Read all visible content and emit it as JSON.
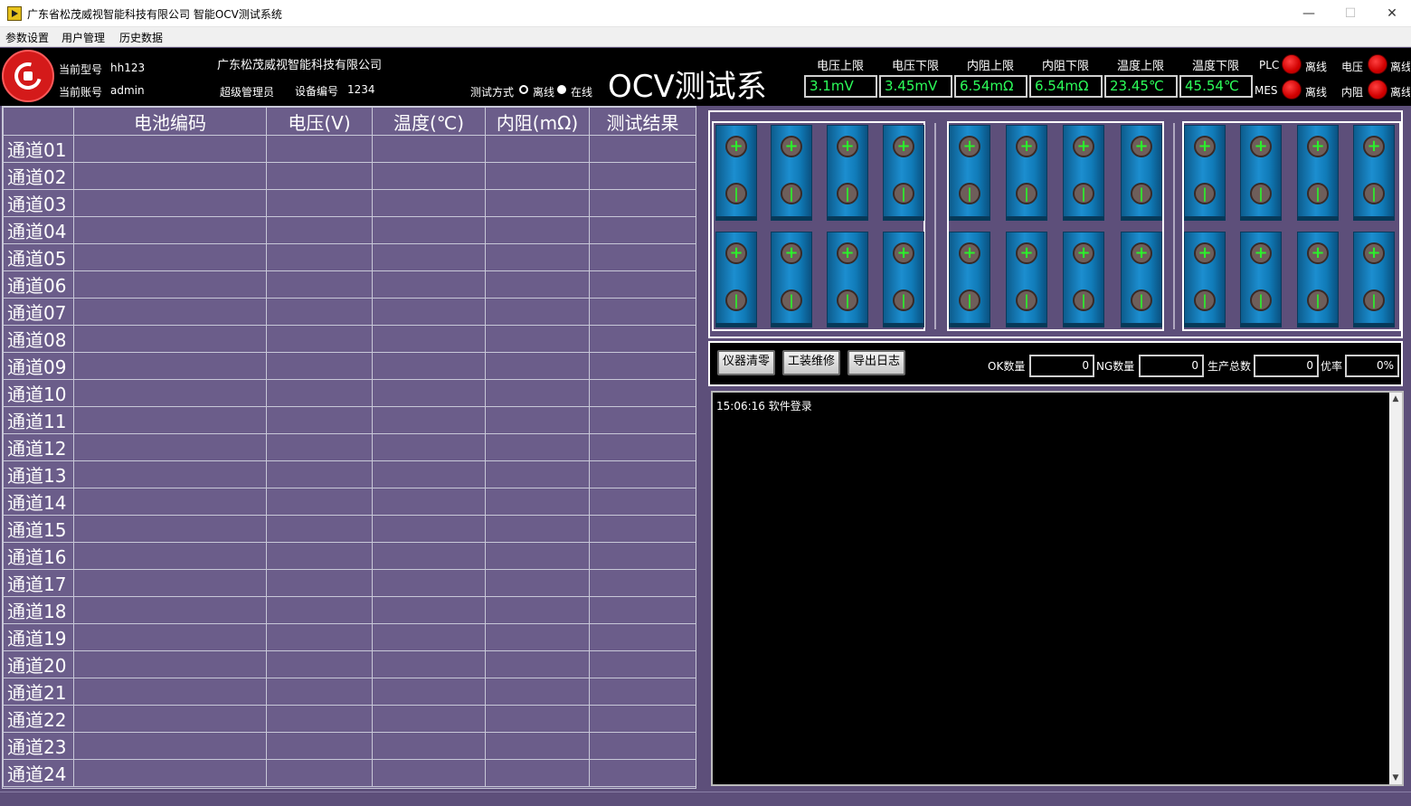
{
  "window": {
    "title": "广东省松茂威视智能科技有限公司 智能OCV测试系统",
    "min": "—",
    "max": "☐",
    "close": "✕"
  },
  "menu": [
    "参数设置",
    "用户管理",
    "历史数据"
  ],
  "header": {
    "model_label": "当前型号",
    "model_value": "hh123",
    "account_label": "当前账号",
    "account_value": "admin",
    "company": "广东松茂威视智能科技有限公司",
    "role": "超级管理员",
    "device_label": "设备编号",
    "device_value": "1234",
    "test_mode_label": "测试方式",
    "mode_offline": "离线",
    "mode_online": "在线",
    "mode_selected": "在线",
    "system_title": "OCV测试系",
    "limits": [
      {
        "label": "电压上限",
        "value": "3.1mV"
      },
      {
        "label": "电压下限",
        "value": "3.45mV"
      },
      {
        "label": "内阻上限",
        "value": "6.54mΩ"
      },
      {
        "label": "内阻下限",
        "value": "6.54mΩ"
      },
      {
        "label": "温度上限",
        "value": "23.45℃"
      },
      {
        "label": "温度下限",
        "value": "45.54℃"
      }
    ],
    "status": [
      {
        "label": "PLC",
        "state": "离线"
      },
      {
        "label": "MES",
        "state": "离线"
      },
      {
        "label": "电压",
        "state": "离线"
      },
      {
        "label": "内阻",
        "state": "离线"
      }
    ],
    "led_color": "#e00000"
  },
  "table": {
    "columns": [
      "",
      "电池编码",
      "电压(V)",
      "温度(℃)",
      "内阻(mΩ)",
      "测试结果"
    ],
    "channels": [
      "通道01",
      "通道02",
      "通道03",
      "通道04",
      "通道05",
      "通道06",
      "通道07",
      "通道08",
      "通道09",
      "通道10",
      "通道11",
      "通道12",
      "通道13",
      "通道14",
      "通道15",
      "通道16",
      "通道17",
      "通道18",
      "通道19",
      "通道20",
      "通道21",
      "通道22",
      "通道23",
      "通道24"
    ]
  },
  "controls": {
    "buttons": [
      "仪器清零",
      "工装维修",
      "导出日志"
    ],
    "ok_label": "OK数量",
    "ok_value": "0",
    "ng_label": "NG数量",
    "ng_value": "0",
    "total_label": "生产总数",
    "total_value": "0",
    "yield_label": "优率",
    "yield_value": "0%"
  },
  "log": {
    "lines": [
      "15:06:16  软件登录"
    ]
  },
  "colors": {
    "background": "#5d4f7a",
    "table_bg": "#6b5d8a",
    "value_green": "#2cff5a",
    "battery_blue": "#1c8ed0"
  },
  "icons": {
    "positive_terminal": "plus-icon",
    "negative_terminal": "minus-icon"
  }
}
